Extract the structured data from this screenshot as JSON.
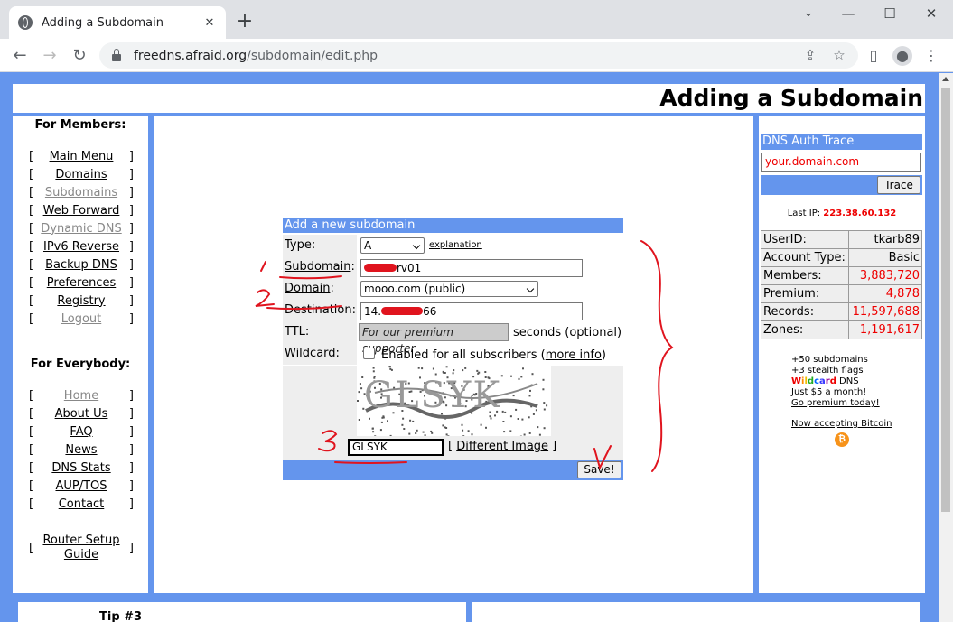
{
  "browser": {
    "tab_title": "Adding a Subdomain",
    "url_host": "freedns.afraid.org",
    "url_path": "/subdomain/edit.php"
  },
  "page": {
    "title": "Adding a Subdomain"
  },
  "members_nav": {
    "heading": "For Members:",
    "items": [
      {
        "label": "Main Menu",
        "active": true
      },
      {
        "label": "Domains",
        "active": true
      },
      {
        "label": "Subdomains",
        "active": false
      },
      {
        "label": "Web Forward",
        "active": true
      },
      {
        "label": "Dynamic DNS",
        "active": false
      },
      {
        "label": "IPv6 Reverse",
        "active": true
      },
      {
        "label": "Backup DNS",
        "active": true
      },
      {
        "label": "Preferences",
        "active": true
      },
      {
        "label": "Registry",
        "active": true
      },
      {
        "label": "Logout",
        "active": false
      }
    ]
  },
  "everybody_nav": {
    "heading": "For Everybody:",
    "items": [
      {
        "label": "Home",
        "active": false
      },
      {
        "label": "About Us",
        "active": true
      },
      {
        "label": "FAQ",
        "active": true
      },
      {
        "label": "News",
        "active": true
      },
      {
        "label": "DNS Stats",
        "active": true
      },
      {
        "label": "AUP/TOS",
        "active": true
      },
      {
        "label": "Contact",
        "active": true
      }
    ],
    "router_line1": "Router Setup",
    "router_line2": "Guide"
  },
  "form": {
    "heading": "Add a new subdomain",
    "type_label": "Type:",
    "type_value": "A",
    "explanation_link": "explanation",
    "subdomain_label": "Subdomain",
    "subdomain_value_suffix": "rv01",
    "domain_label": "Domain",
    "domain_value": "mooo.com (public)",
    "destination_label": "Destination:",
    "destination_prefix": "14.",
    "destination_suffix": "66",
    "ttl_label": "TTL:",
    "ttl_placeholder": "For our premium supporter",
    "ttl_suffix": "seconds (optional)",
    "wildcard_label": "Wildcard:",
    "wildcard_text": "Enabled for all subscribers (",
    "wildcard_more": "more info",
    "wildcard_close": ")",
    "captcha_image_text": "GLSYK",
    "captcha_value": "GLSYK",
    "different_image": "Different Image",
    "save_label": "Save!"
  },
  "dns_trace": {
    "heading": "DNS Auth Trace",
    "input_value": "your.domain.com",
    "trace_label": "Trace"
  },
  "last_ip": {
    "label": "Last IP:",
    "value": "223.38.60.132"
  },
  "stats": [
    {
      "label": "UserID:",
      "value": "tkarb89",
      "red": false
    },
    {
      "label": "Account Type:",
      "value": "Basic",
      "red": false
    },
    {
      "label": "Members:",
      "value": "3,883,720",
      "red": true
    },
    {
      "label": "Premium:",
      "value": "4,878",
      "red": true
    },
    {
      "label": "Records:",
      "value": "11,597,688",
      "red": true
    },
    {
      "label": "Zones:",
      "value": "1,191,617",
      "red": true
    }
  ],
  "promo": {
    "line1": "+50 subdomains",
    "line2": "+3 stealth flags",
    "line3_suffix": " DNS",
    "line4": "Just $5 a month!",
    "line5": "Go premium today!",
    "bitcoin": "Now accepting Bitcoin",
    "wildcard_word": "Wildcard"
  },
  "footer": {
    "tip": "Tip #3"
  },
  "colors": {
    "accent": "#6495ed",
    "annotation": "#e0141e"
  }
}
